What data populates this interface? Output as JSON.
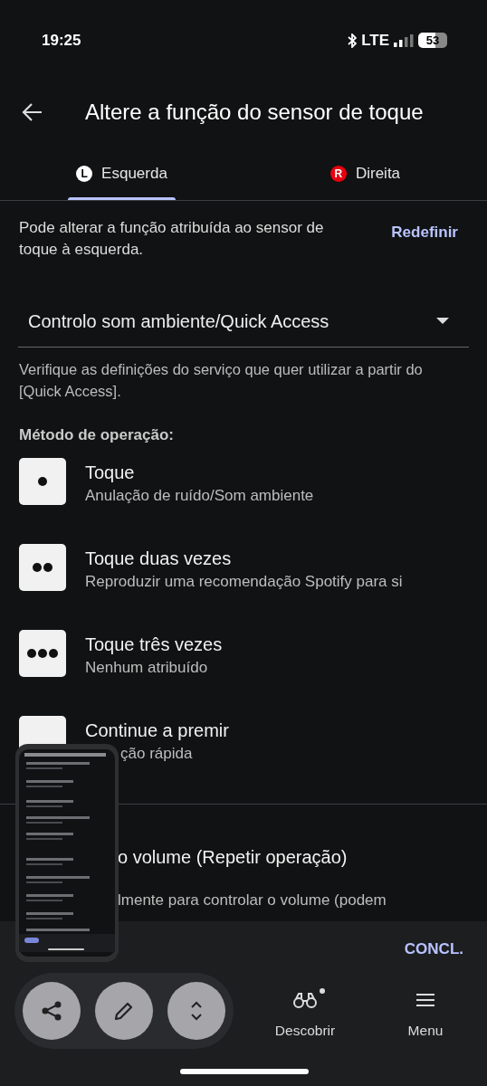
{
  "status_bar": {
    "time": "19:25",
    "network": "LTE",
    "battery": "53"
  },
  "header": {
    "title": "Altere a função do sensor de toque"
  },
  "tabs": [
    {
      "badge": "L",
      "label": "Esquerda",
      "selected": true,
      "color": "#ffffff"
    },
    {
      "badge": "R",
      "label": "Direita",
      "selected": false,
      "color": "#e8000f"
    }
  ],
  "description": "Pode alterar a função atribuída ao sensor de toque à esquerda.",
  "reset_button": "Redefinir",
  "dropdown": {
    "value": "Controlo som ambiente/Quick Access"
  },
  "note": "Verifique as definições do serviço que quer utilizar a partir do [Quick Access].",
  "section_title": "Método de operação:",
  "operations": [
    {
      "kind": "single",
      "title": "Toque",
      "subtitle": "Anulação de ruído/Som ambiente"
    },
    {
      "kind": "double",
      "title": "Toque duas vezes",
      "subtitle": "Reproduzir uma recomendação Spotify para si"
    },
    {
      "kind": "triple",
      "title": "Toque três vezes",
      "subtitle": "Nenhum atribuído"
    },
    {
      "kind": "hold",
      "title": "Continue a premir",
      "subtitle": "ção rápida"
    }
  ],
  "volume_item": {
    "title": "o volume (Repetir operação)",
    "subtitle": "lmente para controlar o volume (podem"
  },
  "bottom_sheet": {
    "done_button": "CONCL."
  },
  "floating_actions": [
    {
      "kind": "share"
    },
    {
      "kind": "edit"
    },
    {
      "kind": "scroll"
    }
  ],
  "nav": [
    {
      "kind": "discover",
      "label": "Descobrir",
      "badge_dot": true
    },
    {
      "kind": "menu",
      "label": "Menu"
    }
  ]
}
